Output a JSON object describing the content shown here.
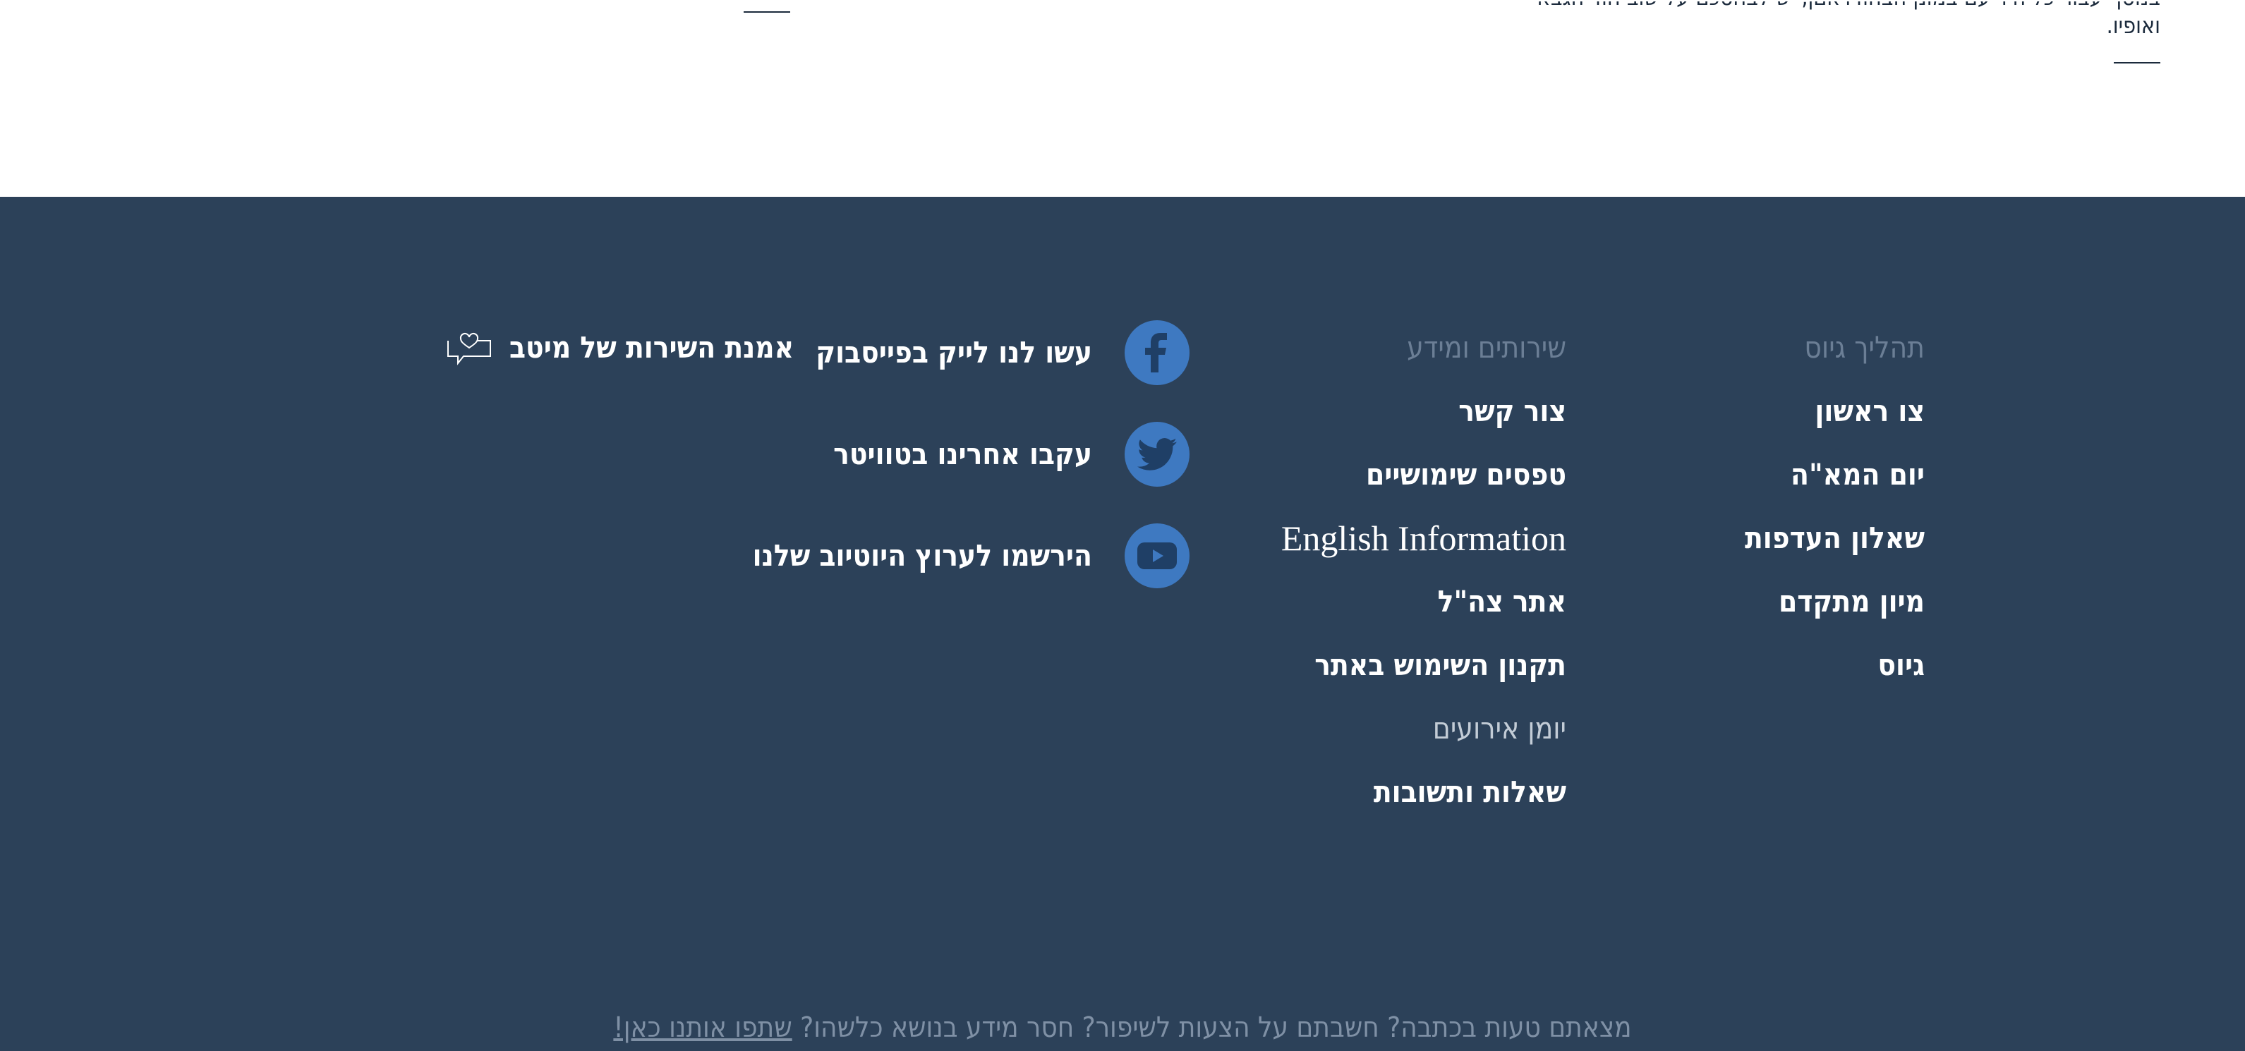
{
  "top": {
    "line1": "בנוסף עבור כל היד עם במונן הבחודדאםן, יש לבחסכם על שוב חוד הגבא",
    "line2": "ואופיו."
  },
  "footer": {
    "process": {
      "title": "תהליך גיוס",
      "items": [
        "צו ראשון",
        "יום המא\"ה",
        "שאלון העדפות",
        "מיון מתקדם",
        "גיוס"
      ]
    },
    "services": {
      "title": "שירותים ומידע",
      "items": [
        "צור קשר",
        "טפסים שימושיים",
        "English Information",
        "אתר צה\"ל",
        "תקנון השימוש באתר",
        "יומן אירועים",
        "שאלות ותשובות"
      ]
    },
    "social": {
      "facebook": "עשו לנו לייק בפייסבוק",
      "twitter": "עקבו אחרינו בטוויטר",
      "youtube": "הירשמו לערוץ היוטיוב שלנו"
    },
    "pledge": "אמנת השירות של מיטב",
    "feedback": {
      "text": "מצאתם טעות בכתבה? חשבתם על הצעות לשיפור? חסר מידע בנושא כלשהו?",
      "link": "שתפו אותנו כאן!"
    }
  },
  "colors": {
    "footer_bg": "#2c4159",
    "social_icon": "#3e79c1",
    "muted_title": "#6b7e95"
  }
}
